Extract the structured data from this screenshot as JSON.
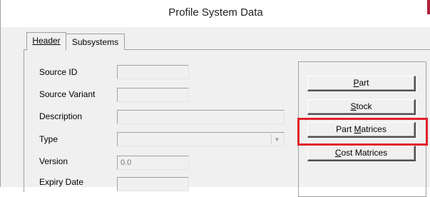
{
  "window": {
    "title": "Profile System Data"
  },
  "tabs": [
    {
      "label": "Header",
      "active": true
    },
    {
      "label": "Subsystems",
      "active": false
    }
  ],
  "form": {
    "source_id_label": "Source ID",
    "source_id_value": "",
    "source_variant_label": "Source Variant",
    "source_variant_value": "",
    "description_label": "Description",
    "description_value": "",
    "type_label": "Type",
    "type_value": "",
    "version_label": "Version",
    "version_value": "0.0",
    "expiry_label": "Expiry Date",
    "expiry_value": ""
  },
  "buttons": {
    "part": {
      "mnemonic": "P",
      "rest": "art"
    },
    "stock": {
      "mnemonic": "S",
      "rest": "tock"
    },
    "part_matrices": {
      "pre": "Part ",
      "mnemonic": "M",
      "rest": "atrices"
    },
    "cost_matrices": {
      "mnemonic": "C",
      "rest": "ost Matrices"
    }
  },
  "colors": {
    "highlight": "#e0202a",
    "title_accent": "#b0203a"
  }
}
